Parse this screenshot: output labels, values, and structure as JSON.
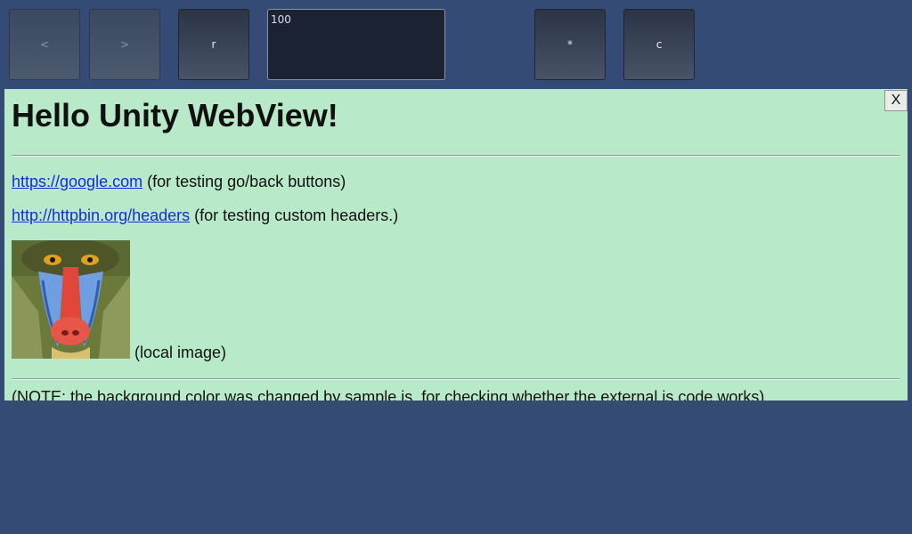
{
  "toolbar": {
    "back_label": "<",
    "forward_label": ">",
    "reload_label": "r",
    "url_field_value": "100",
    "star_label": "*",
    "clear_label": "c"
  },
  "webview": {
    "close_label": "X",
    "heading": "Hello Unity WebView!",
    "links": [
      {
        "text": "https://google.com",
        "note": "(for testing go/back buttons)"
      },
      {
        "text": "http://httpbin.org/headers",
        "note": "(for testing custom headers.)"
      }
    ],
    "image_caption": "(local image)",
    "note": "(NOTE: the background color was changed by sample.js, for checking whether the external js code works)"
  },
  "colors": {
    "unity_background": "#334b75",
    "webview_background": "#b8e9c9",
    "link": "#1a2ad8"
  }
}
